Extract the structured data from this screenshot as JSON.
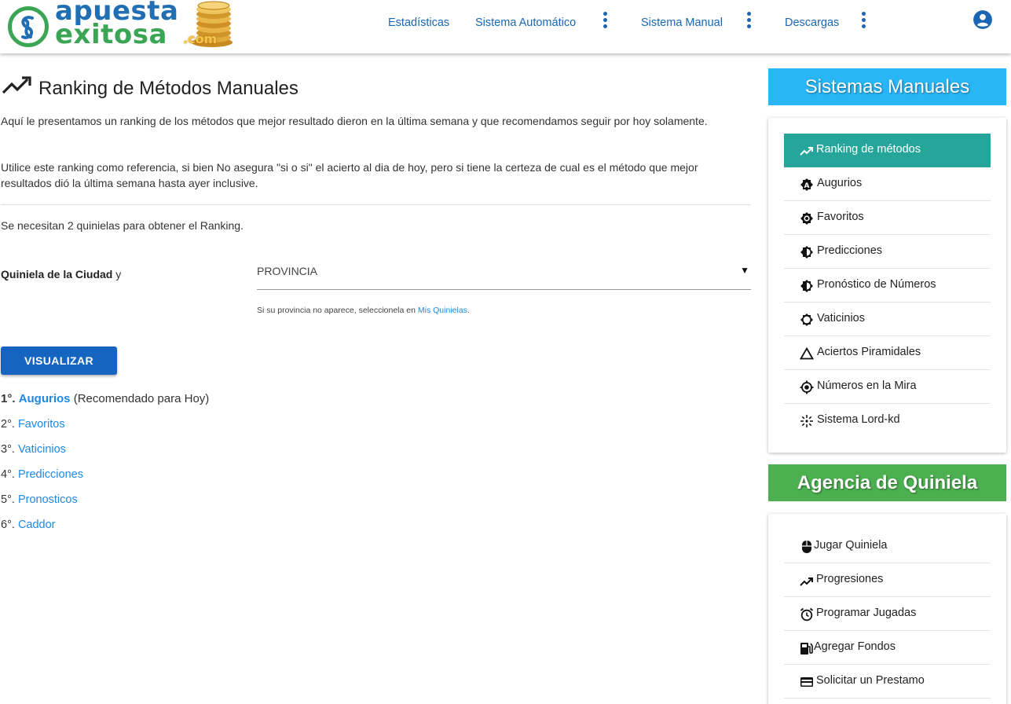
{
  "header": {
    "logo": {
      "word1": "apuesta",
      "word2": "exitosa",
      "suffix": ".com"
    },
    "nav": [
      {
        "label": "Estadísticas",
        "has_menu": false
      },
      {
        "label": "Sistema Automático",
        "has_menu": true
      },
      {
        "label": "Sistema Manual",
        "has_menu": true
      },
      {
        "label": "Descargas",
        "has_menu": true
      }
    ],
    "user_icon": "account-circle-icon"
  },
  "main": {
    "title": "Ranking de Métodos Manuales",
    "title_icon": "trending-up-icon",
    "paragraph1": "Aquí le presentamos un ranking de los métodos que mejor resultado dieron en la última semana y que recomendamos seguir por hoy solamente.",
    "paragraph2": "Utilice este ranking como referencia, si bien No asegura \"si o si\" el acierto al dia de hoy, pero si tiene la certeza de cual es el método que mejor resultados dió la última semana hasta ayer inclusive.",
    "note": "Se necesitan 2 quinielas para obtener el Ranking.",
    "form": {
      "label_bold": "Quiniela de la Ciudad",
      "label_suffix": "y",
      "select_value": "PROVINCIA",
      "hint_text": "Si su provincia no aparece, seleccionela en",
      "hint_link": "Mis Quinielas",
      "hint_end": "."
    },
    "button_label": "VISUALIZAR",
    "ranking": [
      {
        "position": "1°.",
        "name": "Augurios",
        "note": "(Recomendado para Hoy)"
      },
      {
        "position": "2°.",
        "name": "Favoritos",
        "note": ""
      },
      {
        "position": "3°.",
        "name": "Vaticinios",
        "note": ""
      },
      {
        "position": "4°.",
        "name": "Predicciones",
        "note": ""
      },
      {
        "position": "5°.",
        "name": "Pronosticos",
        "note": ""
      },
      {
        "position": "6°.",
        "name": "Caddor",
        "note": ""
      }
    ]
  },
  "sidebar": {
    "manual_title": "Sistemas Manuales",
    "manual_items": [
      {
        "label": "Ranking de métodos",
        "icon": "trending-up-icon",
        "active": true
      },
      {
        "label": "Augurios",
        "icon": "alpha-a-badge-icon",
        "active": false
      },
      {
        "label": "Favoritos",
        "icon": "brightness-icon",
        "active": false
      },
      {
        "label": "Predicciones",
        "icon": "half-brightness-icon",
        "active": false
      },
      {
        "label": "Pronóstico de Números",
        "icon": "half-brightness-icon",
        "active": false
      },
      {
        "label": "Vaticinios",
        "icon": "settings-outline-icon",
        "active": false
      },
      {
        "label": "Aciertos Piramidales",
        "icon": "triangle-outline-icon",
        "active": false
      },
      {
        "label": "Números en la Mira",
        "icon": "crosshairs-gps-icon",
        "active": false
      },
      {
        "label": "Sistema Lord-kd",
        "icon": "sparkle-icon",
        "active": false
      }
    ],
    "agency_title": "Agencia de Quiniela",
    "agency_items": [
      {
        "label": "Jugar Quiniela",
        "icon": "mouse-icon"
      },
      {
        "label": "Progresiones",
        "icon": "trending-up-icon"
      },
      {
        "label": "Programar Jugadas",
        "icon": "alarm-clock-icon"
      },
      {
        "label": "Agregar Fondos",
        "icon": "gas-station-icon"
      },
      {
        "label": "Solicitar un Prestamo",
        "icon": "credit-card-icon"
      }
    ],
    "colors": {
      "manual_banner": "#29b6f6",
      "agency_banner": "#4caf50",
      "active_item": "#26a69a"
    }
  }
}
